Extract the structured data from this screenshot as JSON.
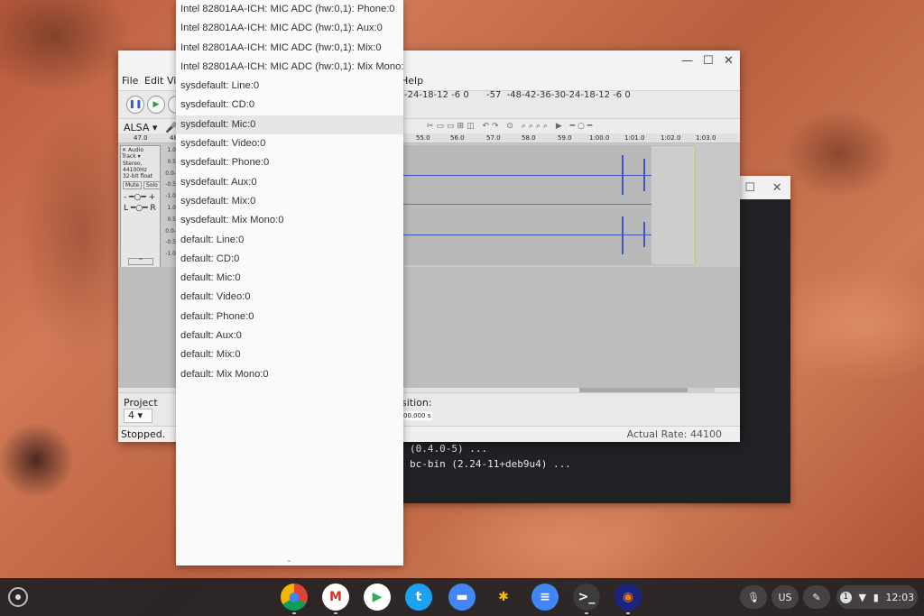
{
  "terminal": {
    "lines": [
      "(0.4.0-5) ...",
      "bc-bin (2.24-11+deb9u4) ..."
    ]
  },
  "audacity": {
    "menus": [
      "File",
      "Edit",
      "Vi",
      "Help"
    ],
    "host": "ALSA",
    "meter_playback": "-24-18-12 -6 0",
    "meter_record": "-57  -48-42-36-30-24-18-12 -6 0",
    "ruler": [
      "47.0",
      "48",
      "55.0",
      "56.0",
      "57.0",
      "58.0",
      "59.0",
      "1:00.0",
      "1:01.0",
      "1:02.0",
      "1:03.0"
    ],
    "track": {
      "name": "Audio Track",
      "info1": "Stereo, 44100Hz",
      "info2": "32-bit float",
      "mute": "Mute",
      "solo": "Solo",
      "scale": [
        "1.0",
        "0.5",
        "0.0-",
        "-0.5",
        "-1.0",
        "1.0",
        "0.5",
        "0.0-",
        "-0.5",
        "-1.0"
      ]
    },
    "project_label": "Project",
    "project_rate": "4",
    "position_label": "sition:",
    "position_value": "00.000 s",
    "status": "Stopped.",
    "actual_rate": "Actual Rate: 44100"
  },
  "dropdown": {
    "selected_index": 6,
    "items": [
      "Intel 82801AA-ICH: MIC ADC (hw:0,1): Phone:0",
      "Intel 82801AA-ICH: MIC ADC (hw:0,1): Aux:0",
      "Intel 82801AA-ICH: MIC ADC (hw:0,1): Mix:0",
      "Intel 82801AA-ICH: MIC ADC (hw:0,1): Mix Mono:0",
      "sysdefault: Line:0",
      "sysdefault: CD:0",
      "sysdefault: Mic:0",
      "sysdefault: Video:0",
      "sysdefault: Phone:0",
      "sysdefault: Aux:0",
      "sysdefault: Mix:0",
      "sysdefault: Mix Mono:0",
      "default: Line:0",
      "default: CD:0",
      "default: Mic:0",
      "default: Video:0",
      "default: Phone:0",
      "default: Aux:0",
      "default: Mix:0",
      "default: Mix Mono:0"
    ]
  },
  "shelf": {
    "apps": [
      {
        "name": "chrome",
        "glyph": "●",
        "color": "#db4437"
      },
      {
        "name": "gmail",
        "glyph": "M",
        "color": "#ffffff"
      },
      {
        "name": "play-store",
        "glyph": "▶",
        "color": "#34a853"
      },
      {
        "name": "twitter",
        "glyph": "t",
        "color": "#1da1f2"
      },
      {
        "name": "files",
        "glyph": "▬",
        "color": "#4285f4"
      },
      {
        "name": "photos",
        "glyph": "✱",
        "color": "#fbbc05"
      },
      {
        "name": "messages",
        "glyph": "≡",
        "color": "#4285f4"
      },
      {
        "name": "terminal",
        "glyph": ">_",
        "color": "#3c3c3c"
      },
      {
        "name": "audacity",
        "glyph": "◉",
        "color": "#f57c00"
      }
    ],
    "ime": "US",
    "notifications": "1",
    "clock": "12:03"
  }
}
